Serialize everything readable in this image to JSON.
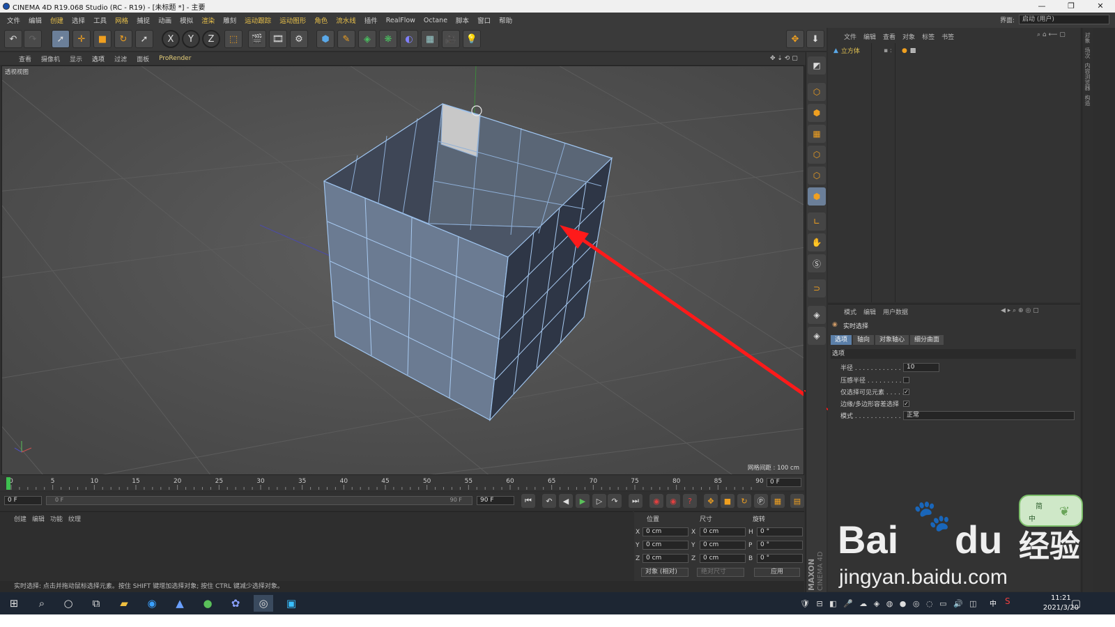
{
  "window": {
    "title": "CINEMA 4D R19.068 Studio (RC - R19) - [未标题 *] - 主要"
  },
  "menubar": {
    "items": [
      "文件",
      "编辑",
      "创建",
      "选择",
      "工具",
      "网格",
      "捕捉",
      "动画",
      "模拟",
      "渲染",
      "雕刻",
      "运动跟踪",
      "运动图形",
      "角色",
      "流水线",
      "插件",
      "RealFlow",
      "Octane",
      "脚本",
      "窗口",
      "帮助"
    ],
    "interface_label": "界面:",
    "interface_value": "启动 (用户)"
  },
  "toolbar": {
    "axis_x": "X",
    "axis_y": "Y",
    "axis_z": "Z"
  },
  "viewport_menu": {
    "items": [
      "查看",
      "摄像机",
      "显示",
      "选项",
      "过滤",
      "面板",
      "ProRender"
    ]
  },
  "viewport": {
    "label": "透视视图",
    "grid_spacing": "网格间距 : 100 cm"
  },
  "object_manager": {
    "tabs": [
      "文件",
      "编辑",
      "查看",
      "对象",
      "标签",
      "书签"
    ],
    "object_name": "立方体"
  },
  "attribute_manager": {
    "tabs": [
      "模式",
      "编辑",
      "用户数据"
    ],
    "title": "实时选择",
    "subtabs": [
      "选项",
      "轴向",
      "对象轴心",
      "细分曲面"
    ],
    "section": "选项",
    "props": [
      {
        "label": "半径 . . . . . . . . . . . .",
        "value": "10"
      },
      {
        "label": "压感半径 . . . . . . . . .",
        "value": ""
      },
      {
        "label": "仅选择可见元素 . . . . .",
        "value": "✓"
      },
      {
        "label": "边缘/多边形容差选择",
        "value": "✓"
      },
      {
        "label": "模式 . . . . . . . . . . . .",
        "value": "正常"
      }
    ]
  },
  "timeline": {
    "ticks": [
      "0",
      "5",
      "10",
      "15",
      "20",
      "25",
      "30",
      "35",
      "40",
      "45",
      "50",
      "55",
      "60",
      "65",
      "70",
      "75",
      "80",
      "85",
      "90"
    ],
    "current_frame": "0 F",
    "start_frame": "0 F",
    "range_start": "0 F",
    "range_end": "90 F",
    "end_frame": "90 F"
  },
  "material_manager": {
    "tabs": [
      "创建",
      "编辑",
      "功能",
      "纹理"
    ]
  },
  "coordinates": {
    "headers": [
      "位置",
      "尺寸",
      "旋转"
    ],
    "rows": [
      {
        "axis": "X",
        "pos": "0 cm",
        "size_axis": "X",
        "size": "0 cm",
        "rot_axis": "H",
        "rot": "0 °"
      },
      {
        "axis": "Y",
        "pos": "0 cm",
        "size_axis": "Y",
        "size": "0 cm",
        "rot_axis": "P",
        "rot": "0 °"
      },
      {
        "axis": "Z",
        "pos": "0 cm",
        "size_axis": "Z",
        "size": "0 cm",
        "rot_axis": "B",
        "rot": "0 °"
      }
    ],
    "mode_select": "对象 (相对)",
    "size_select": "绝对尺寸",
    "apply_button": "应用"
  },
  "status_bar": {
    "text": "实时选择: 点击并拖动鼠标选择元素。按住 SHIFT 键增加选择对象; 按住 CTRL 键减少选择对象。"
  },
  "branding": {
    "maxon": "MAXON",
    "cinema": "CINEMA 4D"
  },
  "ime": {
    "mode": "简",
    "lang": "中"
  },
  "taskbar": {
    "time": "11:21",
    "date": "2021/3/20",
    "ime_lang": "中"
  },
  "watermark": {
    "brand": "Bai",
    "brand2": "du",
    "cn": "经验",
    "url": "jingyan.baidu.com"
  },
  "colors": {
    "accent_red": "#ff1a1a",
    "selected_blue": "#5b7fa8",
    "title_yellow": "#e0c050"
  }
}
